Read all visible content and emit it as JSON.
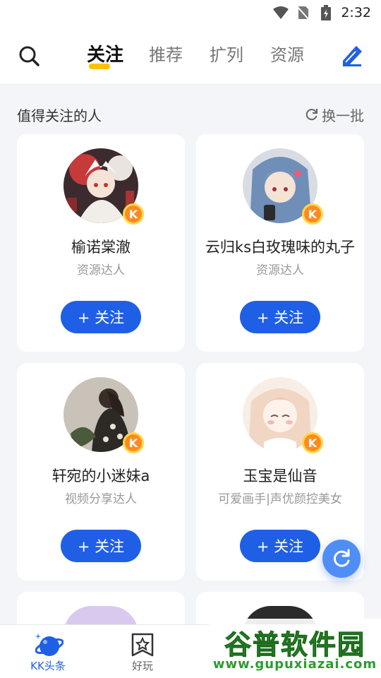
{
  "status_bar": {
    "time": "2:32"
  },
  "nav": {
    "tabs": [
      {
        "label": "关注",
        "active": true
      },
      {
        "label": "推荐",
        "active": false
      },
      {
        "label": "扩列",
        "active": false
      },
      {
        "label": "资源",
        "active": false
      }
    ]
  },
  "section": {
    "title": "值得关注的人",
    "refresh_label": "换一批"
  },
  "cards": [
    {
      "name": "榆诺棠澈",
      "role": "资源达人",
      "follow_label": "+ 关注",
      "badge": "K"
    },
    {
      "name": "云归ks白玫瑰味的丸子",
      "role": "资源达人",
      "follow_label": "+ 关注",
      "badge": "K"
    },
    {
      "name": "轩宛的小迷妹a",
      "role": "视频分享达人",
      "follow_label": "+ 关注",
      "badge": "K"
    },
    {
      "name": "玉宝是仙音",
      "role": "可爱画手|声优颜控美女",
      "follow_label": "+ 关注",
      "badge": "K"
    }
  ],
  "bottom_nav": [
    {
      "label": "KK头条",
      "icon": "planet-icon",
      "active": true
    },
    {
      "label": "好玩",
      "icon": "star-bookmark-icon",
      "active": false
    }
  ],
  "watermark": {
    "title": "谷普软件园",
    "url": "www.gupuxiazai.com"
  },
  "colors": {
    "accent": "#1f5fe6",
    "tab_underline": "#ffc107",
    "badge": "#ff8a1f"
  }
}
